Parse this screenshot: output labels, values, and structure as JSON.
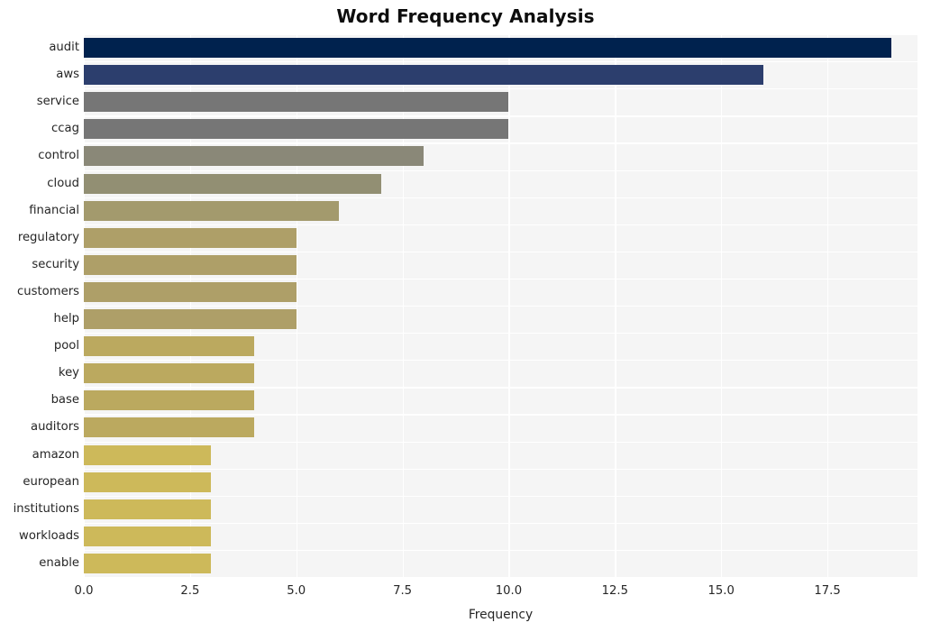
{
  "chart_data": {
    "type": "bar",
    "orientation": "horizontal",
    "title": "Word Frequency Analysis",
    "xlabel": "Frequency",
    "ylabel": "",
    "categories": [
      "audit",
      "aws",
      "service",
      "ccag",
      "control",
      "cloud",
      "financial",
      "regulatory",
      "security",
      "customers",
      "help",
      "pool",
      "key",
      "base",
      "auditors",
      "amazon",
      "european",
      "institutions",
      "workloads",
      "enable"
    ],
    "values": [
      19,
      16,
      10,
      10,
      8,
      7,
      6,
      5,
      5,
      5,
      5,
      4,
      4,
      4,
      4,
      3,
      3,
      3,
      3,
      3
    ],
    "colors": [
      "#00224e",
      "#2c3e6d",
      "#767676",
      "#767676",
      "#8a8878",
      "#928f73",
      "#a39a6d",
      "#ae9f68",
      "#ae9f68",
      "#ae9f68",
      "#ae9f68",
      "#bba95f",
      "#bba95f",
      "#bba95f",
      "#bba95f",
      "#cdb95a",
      "#cdb95a",
      "#cdb95a",
      "#cdb95a",
      "#cdb95a"
    ],
    "xlim": [
      0,
      19.62
    ],
    "ylim_categories": 20,
    "xticks": [
      "0.0",
      "2.5",
      "5.0",
      "7.5",
      "10.0",
      "12.5",
      "15.0",
      "17.5"
    ],
    "xtick_values": [
      0,
      2.5,
      5,
      7.5,
      10,
      12.5,
      15,
      17.5
    ],
    "grid": true,
    "grid_color": "#ffffff",
    "plot_background": "#f5f5f5",
    "figure_background": "#ffffff",
    "legend": null,
    "style": "whitegrid",
    "colormap": "cividis"
  }
}
